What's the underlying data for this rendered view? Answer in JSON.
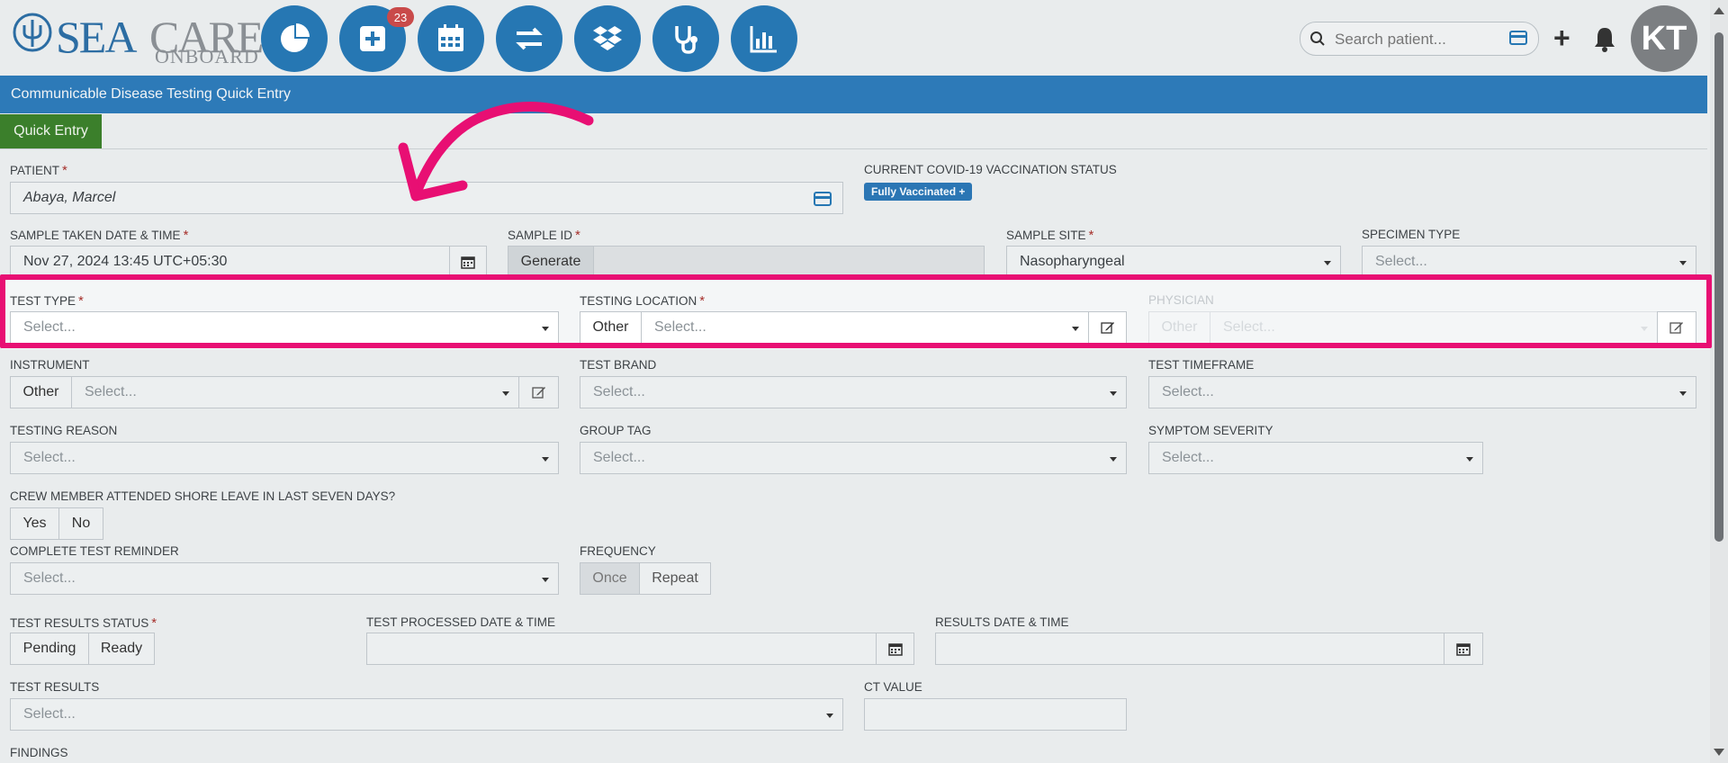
{
  "app": {
    "logo_sea": "SEA",
    "logo_care": "CARE",
    "logo_onboard": "ONBOARD",
    "nav_badge": "23",
    "search_placeholder": "Search patient...",
    "avatar_initials": "KT"
  },
  "nav_icons": [
    "dashboard-pie-icon",
    "add-record-icon",
    "calendar-icon",
    "transfer-icon",
    "dropbox-icon",
    "stethoscope-icon",
    "reports-chart-icon"
  ],
  "page": {
    "title": "Communicable Disease Testing Quick Entry",
    "tab_label": "Quick Entry"
  },
  "form": {
    "patient_label": "PATIENT",
    "patient_value": "Abaya, Marcel",
    "vacc_status_label": "CURRENT COVID-19 VACCINATION STATUS",
    "vacc_status_value": "Fully Vaccinated +",
    "sample_taken_label": "SAMPLE TAKEN DATE & TIME",
    "sample_taken_value": "Nov 27, 2024 13:45 UTC+05:30",
    "sample_id_label": "SAMPLE ID",
    "sample_id_button": "Generate",
    "sample_site_label": "SAMPLE SITE",
    "sample_site_value": "Nasopharyngeal",
    "specimen_type_label": "SPECIMEN TYPE",
    "test_type_label": "TEST TYPE",
    "testing_location_label": "TESTING LOCATION",
    "physician_label": "PHYSICIAN",
    "instrument_label": "INSTRUMENT",
    "test_brand_label": "TEST BRAND",
    "test_timeframe_label": "TEST TIMEFRAME",
    "testing_reason_label": "TESTING REASON",
    "group_tag_label": "GROUP TAG",
    "symptom_severity_label": "SYMPTOM SEVERITY",
    "shore_leave_label": "CREW MEMBER ATTENDED SHORE LEAVE IN LAST SEVEN DAYS?",
    "yes": "Yes",
    "no": "No",
    "reminder_label": "COMPLETE TEST REMINDER",
    "frequency_label": "FREQUENCY",
    "once": "Once",
    "repeat": "Repeat",
    "results_status_label": "TEST RESULTS STATUS",
    "pending": "Pending",
    "ready": "Ready",
    "processed_label": "TEST PROCESSED DATE & TIME",
    "results_dt_label": "RESULTS DATE & TIME",
    "test_results_label": "TEST RESULTS",
    "ct_value_label": "CT VALUE",
    "findings_label": "FINDINGS",
    "other": "Other",
    "select_placeholder": "Select..."
  },
  "colors": {
    "header_blue": "#2d7ab8",
    "tab_green": "#3b7f2b",
    "highlight_pink": "#e80f73",
    "required_red": "#a6302c"
  }
}
